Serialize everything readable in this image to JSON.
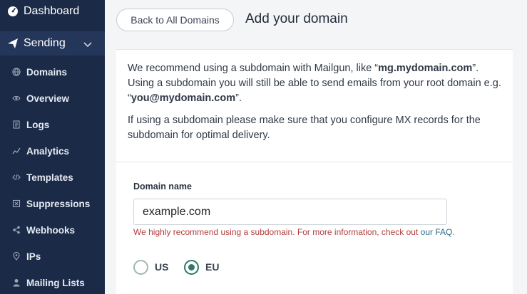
{
  "sidebar": {
    "dashboard": {
      "label": "Dashboard",
      "icon": "dashboard-gauge-icon"
    },
    "sending": {
      "label": "Sending",
      "icon": "paper-plane-icon",
      "expanded": true
    },
    "items": [
      {
        "label": "Domains",
        "icon": "globe-icon"
      },
      {
        "label": "Overview",
        "icon": "eye-icon"
      },
      {
        "label": "Logs",
        "icon": "document-icon"
      },
      {
        "label": "Analytics",
        "icon": "chart-line-icon"
      },
      {
        "label": "Templates",
        "icon": "code-icon"
      },
      {
        "label": "Suppressions",
        "icon": "block-box-icon"
      },
      {
        "label": "Webhooks",
        "icon": "share-nodes-icon"
      },
      {
        "label": "IPs",
        "icon": "location-pin-icon"
      },
      {
        "label": "Mailing Lists",
        "icon": "user-icon"
      }
    ]
  },
  "header": {
    "back_label": "Back to All Domains",
    "title": "Add your domain"
  },
  "info": {
    "p1_prefix": "We recommend using a subdomain with Mailgun, like “",
    "p1_bold1": "mg.mydomain.com",
    "p1_mid": "”. Using a subdomain you will still be able to send emails from your root domain e.g. “",
    "p1_bold2": "you@mydomain.com",
    "p1_suffix": "”.",
    "p2": "If using a subdomain please make sure that you configure MX records for the subdomain for optimal delivery."
  },
  "form": {
    "domain_label": "Domain name",
    "domain_value": "example.com",
    "help_text": "We highly recommend using a subdomain. For more information, check out ",
    "help_link": "our FAQ",
    "help_end": ".",
    "regions": [
      {
        "label": "US",
        "checked": false
      },
      {
        "label": "EU",
        "checked": true
      }
    ]
  },
  "colors": {
    "sidebar_bg": "#1b2a47",
    "accent_green": "#2c7a68",
    "help_red": "#b23c3c"
  }
}
